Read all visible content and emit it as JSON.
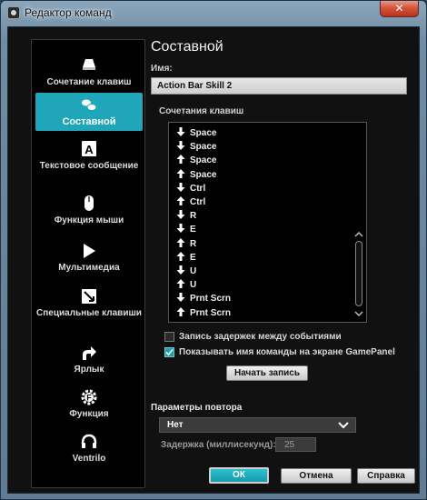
{
  "window": {
    "title": "Редактор команд",
    "close_glyph": "✕"
  },
  "sidebar": {
    "items": [
      {
        "label": "Сочетание клавиш",
        "icon": "key-combo-icon"
      },
      {
        "label": "Составной",
        "icon": "multikey-icon",
        "active": true
      },
      {
        "label": "Текстовое сообщение",
        "icon": "text-a-icon"
      },
      {
        "label": "Функция мыши",
        "icon": "mouse-icon"
      },
      {
        "label": "Мультимедиа",
        "icon": "play-icon"
      },
      {
        "label": "Специальные клавиши",
        "icon": "special-keys-icon"
      },
      {
        "label": "Ярлык",
        "icon": "shortcut-arrow-icon"
      },
      {
        "label": "Функция",
        "icon": "function-gear-icon"
      },
      {
        "label": "Ventrilo",
        "icon": "headset-icon"
      }
    ]
  },
  "main": {
    "heading": "Составной",
    "name_label": "Имя:",
    "name_value": "Action Bar Skill 2",
    "keys_label": "Сочетания клавиш",
    "keys": [
      {
        "dir": "down",
        "key": "Space"
      },
      {
        "dir": "down",
        "key": "Space"
      },
      {
        "dir": "up",
        "key": "Space"
      },
      {
        "dir": "up",
        "key": "Space"
      },
      {
        "dir": "down",
        "key": "Ctrl"
      },
      {
        "dir": "up",
        "key": "Ctrl"
      },
      {
        "dir": "down",
        "key": "R"
      },
      {
        "dir": "down",
        "key": "E"
      },
      {
        "dir": "up",
        "key": "R"
      },
      {
        "dir": "up",
        "key": "E"
      },
      {
        "dir": "down",
        "key": "U"
      },
      {
        "dir": "up",
        "key": "U"
      },
      {
        "dir": "down",
        "key": "Prnt Scrn"
      },
      {
        "dir": "up",
        "key": "Prnt Scrn"
      }
    ],
    "record_delays_label": "Запись задержек между событиями",
    "record_delays_checked": false,
    "show_name_label": "Показывать имя команды на экране GamePanel",
    "show_name_checked": true,
    "start_record_label": "Начать запись",
    "repeat_section_label": "Параметры повтора",
    "repeat_selected": "Нет",
    "delay_label": "Задержка (миллисекунд):",
    "delay_value": "25"
  },
  "footer": {
    "ok_label": "ОК",
    "cancel_label": "Отмена",
    "help_label": "Справка"
  },
  "colors": {
    "accent": "#1fa6b8",
    "background": "#111111",
    "sidebar_bg": "#000000"
  }
}
